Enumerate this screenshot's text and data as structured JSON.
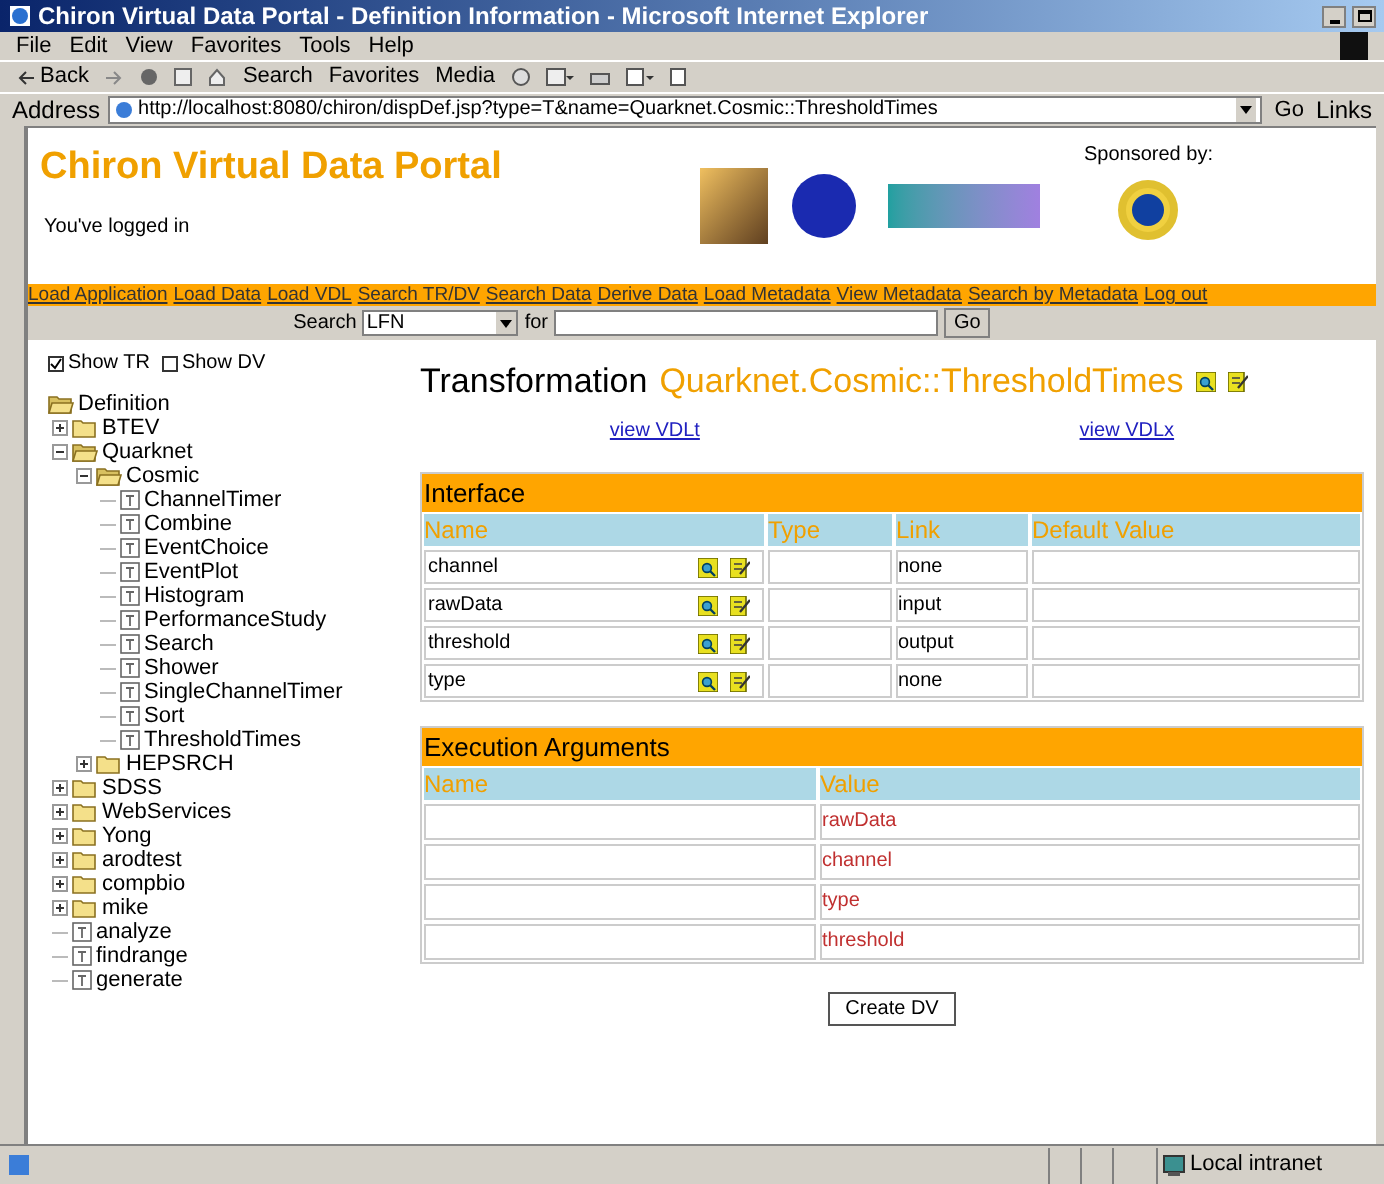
{
  "window": {
    "title": "Chiron Virtual Data Portal - Definition Information - Microsoft Internet Explorer"
  },
  "menu": [
    "File",
    "Edit",
    "View",
    "Favorites",
    "Tools",
    "Help"
  ],
  "toolbar": {
    "back": "Back",
    "search": "Search",
    "favorites": "Favorites",
    "media": "Media"
  },
  "address": {
    "label": "Address",
    "url": "http://localhost:8080/chiron/dispDef.jsp?type=T&name=Quarknet.Cosmic::ThresholdTimes",
    "go": "Go",
    "links": "Links"
  },
  "header": {
    "title": "Chiron Virtual Data Portal",
    "status": "You've logged in",
    "sponsored": "Sponsored by:"
  },
  "nav": [
    "Load Application",
    "Load Data",
    "Load VDL",
    "Search TR/DV",
    "Search Data",
    "Derive Data",
    "Load Metadata",
    "View Metadata",
    "Search by Metadata",
    "Log out"
  ],
  "search": {
    "label": "Search",
    "select": "LFN",
    "for": "for",
    "go": "Go"
  },
  "filters": [
    {
      "label": "Show TR",
      "checked": true
    },
    {
      "label": "Show DV",
      "checked": false
    }
  ],
  "tree": [
    {
      "label": "Definition",
      "kind": "folder",
      "expanded": true,
      "children": [
        {
          "label": "BTEV",
          "kind": "folder",
          "expanded": false
        },
        {
          "label": "Quarknet",
          "kind": "folder",
          "expanded": true,
          "children": [
            {
              "label": "Cosmic",
              "kind": "folder",
              "expanded": true,
              "children": [
                {
                  "label": "ChannelTimer",
                  "kind": "file"
                },
                {
                  "label": "Combine",
                  "kind": "file"
                },
                {
                  "label": "EventChoice",
                  "kind": "file"
                },
                {
                  "label": "EventPlot",
                  "kind": "file"
                },
                {
                  "label": "Histogram",
                  "kind": "file"
                },
                {
                  "label": "PerformanceStudy",
                  "kind": "file"
                },
                {
                  "label": "Search",
                  "kind": "file"
                },
                {
                  "label": "Shower",
                  "kind": "file"
                },
                {
                  "label": "SingleChannelTimer",
                  "kind": "file"
                },
                {
                  "label": "Sort",
                  "kind": "file"
                },
                {
                  "label": "ThresholdTimes",
                  "kind": "file"
                }
              ]
            },
            {
              "label": "HEPSRCH",
              "kind": "folder",
              "expanded": false
            }
          ]
        },
        {
          "label": "SDSS",
          "kind": "folder",
          "expanded": false
        },
        {
          "label": "WebServices",
          "kind": "folder",
          "expanded": false
        },
        {
          "label": "Yong",
          "kind": "folder",
          "expanded": false
        },
        {
          "label": "arodtest",
          "kind": "folder",
          "expanded": false
        },
        {
          "label": "compbio",
          "kind": "folder",
          "expanded": false
        },
        {
          "label": "mike",
          "kind": "folder",
          "expanded": false
        },
        {
          "label": "analyze",
          "kind": "file"
        },
        {
          "label": "findrange",
          "kind": "file"
        },
        {
          "label": "generate",
          "kind": "file"
        }
      ]
    }
  ],
  "definition": {
    "type": "Transformation",
    "name": "Quarknet.Cosmic::ThresholdTimes",
    "links": [
      "view VDLt",
      "view VDLx"
    ]
  },
  "interface": {
    "title": "Interface",
    "columns": [
      "Name",
      "Type",
      "Link",
      "Default Value"
    ],
    "rows": [
      {
        "name": "channel",
        "type_value": "",
        "link": "none"
      },
      {
        "name": "rawData",
        "type_value": "",
        "link": "input"
      },
      {
        "name": "threshold",
        "type_value": "",
        "link": "output"
      },
      {
        "name": "type",
        "type_value": "",
        "link": "none"
      }
    ]
  },
  "arguments": {
    "title": "Execution Arguments",
    "columns": [
      "Name",
      "Value"
    ],
    "rows": [
      "rawData",
      "channel",
      "type",
      "threshold"
    ]
  },
  "create_button": "Create DV",
  "status_bar": {
    "zone": "Local intranet"
  }
}
